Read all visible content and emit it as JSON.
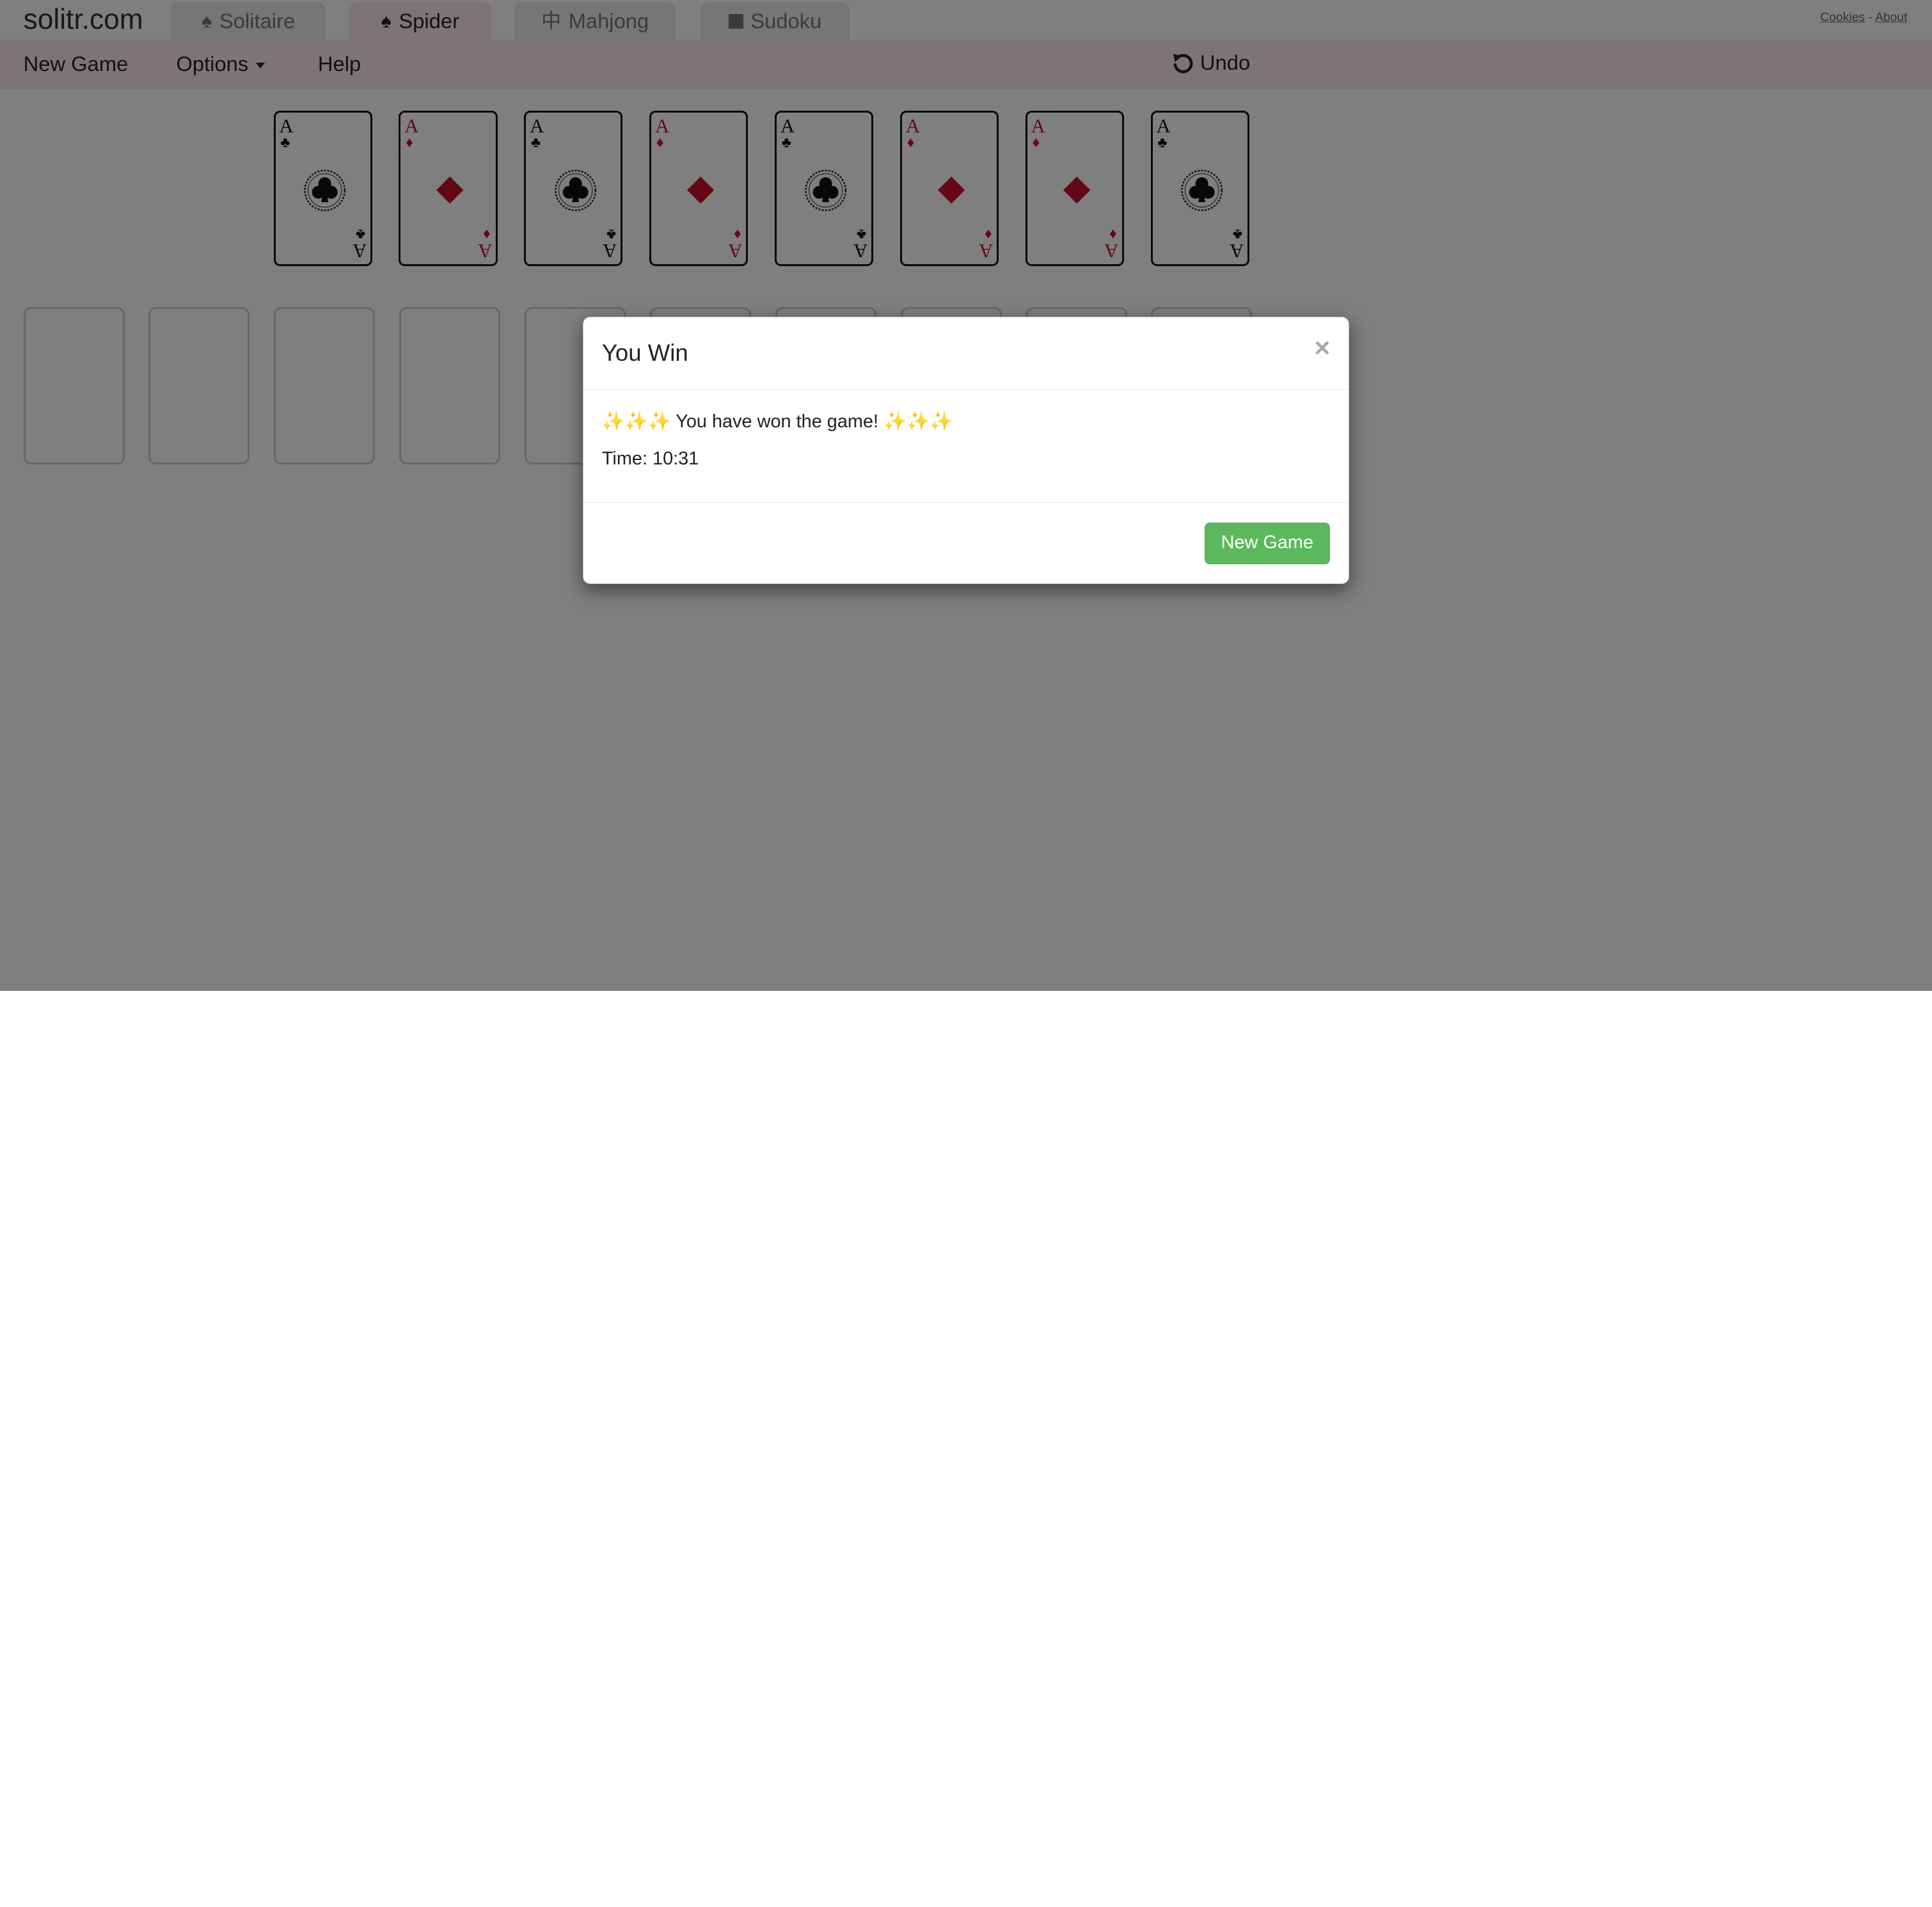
{
  "site": {
    "name": "solitr.com"
  },
  "tabs": [
    {
      "label": "Solitaire",
      "icon": "spade-icon"
    },
    {
      "label": "Spider",
      "icon": "spade-icon",
      "active": true
    },
    {
      "label": "Mahjong",
      "icon": "mahjong-zhong-icon",
      "glyph": "中"
    },
    {
      "label": "Sudoku",
      "icon": "square-icon"
    }
  ],
  "toplinks": {
    "cookies": "Cookies",
    "separator": "-",
    "about": "About"
  },
  "menu": {
    "new_game": "New Game",
    "options": "Options",
    "help": "Help",
    "undo": "Undo"
  },
  "foundation": [
    {
      "rank": "A",
      "suit": "clubs",
      "symbol": "♣",
      "color": "#111111"
    },
    {
      "rank": "A",
      "suit": "diamonds",
      "symbol": "♦",
      "color": "#c8102e"
    },
    {
      "rank": "A",
      "suit": "clubs",
      "symbol": "♣",
      "color": "#111111"
    },
    {
      "rank": "A",
      "suit": "diamonds",
      "symbol": "♦",
      "color": "#c8102e"
    },
    {
      "rank": "A",
      "suit": "clubs",
      "symbol": "♣",
      "color": "#111111"
    },
    {
      "rank": "A",
      "suit": "diamonds",
      "symbol": "♦",
      "color": "#c8102e"
    },
    {
      "rank": "A",
      "suit": "diamonds",
      "symbol": "♦",
      "color": "#c8102e"
    },
    {
      "rank": "A",
      "suit": "clubs",
      "symbol": "♣",
      "color": "#111111"
    }
  ],
  "tableau_empty_slots": 10,
  "modal": {
    "title": "You Win",
    "close": "×",
    "sparkles": "✨✨✨",
    "message": "You have won the game!",
    "time_label": "Time:",
    "time_value": "10:31",
    "button": "New Game"
  },
  "colors": {
    "win_button": "#5cb85c",
    "menubar": "#fbe9f4",
    "red_suit": "#c8102e"
  }
}
